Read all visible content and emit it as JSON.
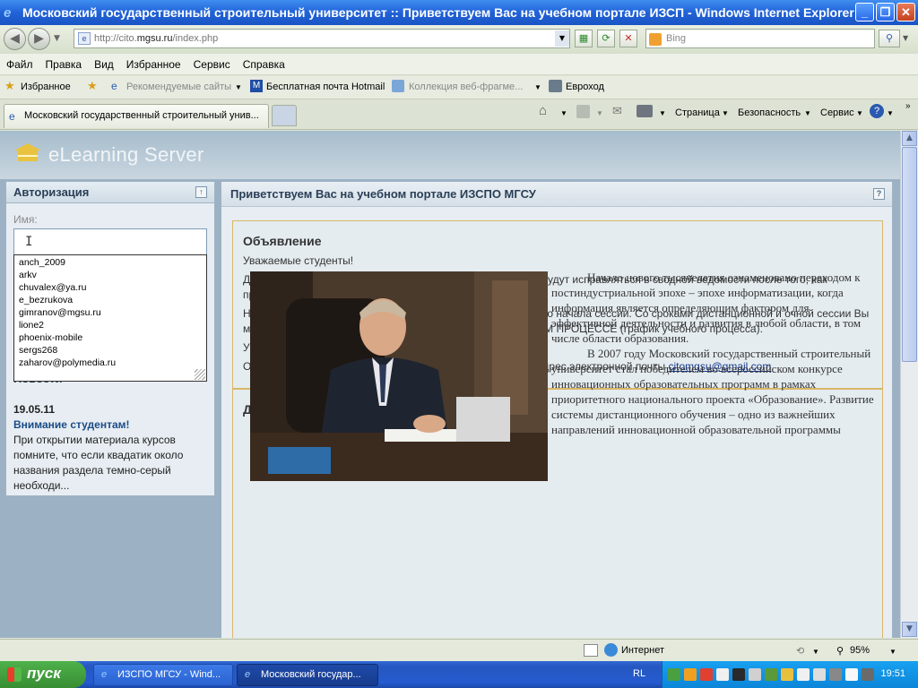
{
  "window": {
    "title": "Московский государственный строительный университет :: Приветствуем Вас на учебном портале ИЗСП - Windows Internet Explorer"
  },
  "address_bar": {
    "url_prefix": "http://cito.",
    "url_domain": "mgsu.ru",
    "url_path": "/index.php",
    "search_placeholder": "Bing"
  },
  "menu": [
    "Файл",
    "Правка",
    "Вид",
    "Избранное",
    "Сервис",
    "Справка"
  ],
  "favorites_bar": {
    "favorites_label": "Избранное",
    "items": [
      "Рекомендуемые сайты",
      "Бесплатная почта Hotmail",
      "Коллекция веб-фрагме...",
      "Евроход"
    ]
  },
  "tab": {
    "active_title": "Московский государственный строительный унив..."
  },
  "command_bar": {
    "page": "Страница",
    "safety": "Безопасность",
    "tools": "Сервис"
  },
  "site": {
    "logo": "eLearning Server",
    "auth_panel": {
      "title": "Авторизация",
      "name_label": "Имя:",
      "autocomplete": [
        "anch_2009",
        "arkv",
        "chuvalex@ya.ru",
        "e_bezrukova",
        "gimranov@mgsu.ru",
        "lione2",
        "phoenix-mobile",
        "sergs268",
        "zaharov@polymedia.ru"
      ]
    },
    "news": {
      "title": "Новости",
      "date": "19.05.11",
      "headline": "Внимание студентам!",
      "text": "При открытии материала курсов помните, что если квадатик около названия раздела темно-серый необходи..."
    },
    "main": {
      "title": "Приветствуем Вас на учебном портале ИЗСПО МГСУ",
      "announcement": {
        "heading": "Объявление",
        "p1": "Уважаемые студенты!",
        "p2": "Долги, неисправленные по интересующим Вас предметам, будут исправляться в сводной ведомости после того, как преподаватель предоставит ведомости в деканат.",
        "p3": "Необходимо сдать все задания, размещенные на портале, до начала сессии. Со сроками дистанционной и очной сессии Вы можете ознакомиться на курсе ИНФОРМАЦИЯ ОБ УЧЕБНОМ ПРОЦЕССЕ (график учебного процесса).",
        "p4": "Учебная администрация МГСУ УК ЗДО.",
        "p5_prefix": "Обо всех ошибках в работе портала, просим сообщать на адрес электронной почты ",
        "email": "citomgsu@gmail.com"
      },
      "friends": {
        "heading": "Дорогие друзья!",
        "p1": "Начало нового тысячелетия ознаменовано переходом к постиндустриальной эпохе – эпохе информатизации, когда информация является определяющим фактором для эффективной деятельности и развития в любой области, в том числе области образования.",
        "p2": "В 2007 году Московский государственный строительный университет стал победителем во всероссийском конкурсе инновационных образовательных программ в рамках приоритетного национального проекта «Образование». Развитие системы дистанционного обучения – одно из важнейших направлений инновационной образовательной программы"
      }
    }
  },
  "status_bar": {
    "zone": "Интернет",
    "zoom": "95%"
  },
  "taskbar": {
    "start": "пуск",
    "buttons": [
      "ИЗСПО МГСУ - Wind...",
      "Московский государ..."
    ],
    "lang": "RL",
    "clock": "19:51"
  },
  "colors": {
    "titlebar": "#2162d8",
    "header": "#a6bccd",
    "panel": "#e7edf2",
    "accent_gold": "#d9b766",
    "start_green": "#388e33"
  }
}
